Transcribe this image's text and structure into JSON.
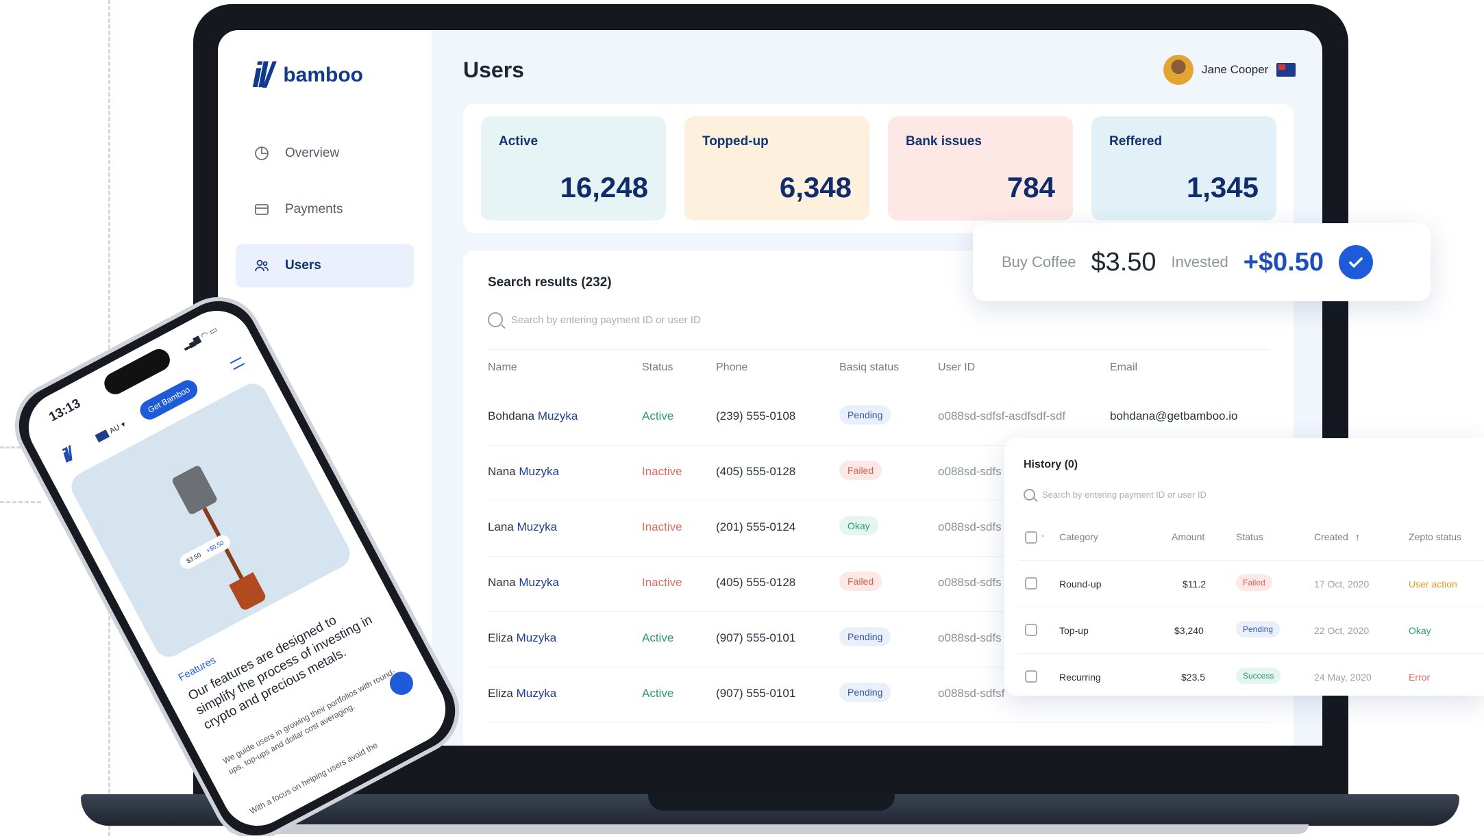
{
  "brand": {
    "name": "bamboo",
    "logo_mark": "il/"
  },
  "sidebar": {
    "items": [
      {
        "label": "Overview",
        "icon": "pie-chart-icon",
        "active": false
      },
      {
        "label": "Payments",
        "icon": "card-icon",
        "active": false
      },
      {
        "label": "Users",
        "icon": "users-icon",
        "active": true
      }
    ]
  },
  "header": {
    "title": "Users",
    "user_name": "Jane Cooper",
    "flag": "australia-flag-icon"
  },
  "stats": [
    {
      "label": "Active",
      "value": "16,248",
      "color": "#e6f4f5"
    },
    {
      "label": "Topped-up",
      "value": "6,348",
      "color": "#fdf0dc"
    },
    {
      "label": "Bank issues",
      "value": "784",
      "color": "#fde8e6"
    },
    {
      "label": "Reffered",
      "value": "1,345",
      "color": "#e2f1f8"
    }
  ],
  "results": {
    "title": "Search results (232)",
    "search_placeholder": "Search by entering payment ID or user ID",
    "columns": [
      "Name",
      "Status",
      "Phone",
      "Basiq status",
      "User ID",
      "Email"
    ],
    "rows": [
      {
        "first": "Bohdana",
        "last": "Muzyka",
        "status": "Active",
        "phone": "(239) 555-0108",
        "basiq": "Pending",
        "user_id": "o088sd-sdfsf-asdfsdf-sdf",
        "email": "bohdana@getbamboo.io"
      },
      {
        "first": "Nana",
        "last": "Muzyka",
        "status": "Inactive",
        "phone": "(405) 555-0128",
        "basiq": "Failed",
        "user_id": "o088sd-sdfs",
        "email": ""
      },
      {
        "first": "Lana",
        "last": "Muzyka",
        "status": "Inactive",
        "phone": "(201) 555-0124",
        "basiq": "Okay",
        "user_id": "o088sd-sdfs",
        "email": ""
      },
      {
        "first": "Nana",
        "last": "Muzyka",
        "status": "Inactive",
        "phone": "(405) 555-0128",
        "basiq": "Failed",
        "user_id": "o088sd-sdfs",
        "email": ""
      },
      {
        "first": "Eliza",
        "last": "Muzyka",
        "status": "Active",
        "phone": "(907) 555-0101",
        "basiq": "Pending",
        "user_id": "o088sd-sdfs",
        "email": ""
      },
      {
        "first": "Eliza",
        "last": "Muzyka",
        "status": "Active",
        "phone": "(907) 555-0101",
        "basiq": "Pending",
        "user_id": "o088sd-sdfsf",
        "email": ""
      }
    ]
  },
  "coffee_card": {
    "label": "Buy Coffee",
    "amount": "$3.50",
    "invested_label": "Invested",
    "invested_amount": "+$0.50"
  },
  "history": {
    "title": "History (0)",
    "search_placeholder": "Search by entering payment ID or user ID",
    "columns": [
      "Category",
      "Amount",
      "Status",
      "Created",
      "Zepto status"
    ],
    "rows": [
      {
        "category": "Round-up",
        "amount": "$11.2",
        "status": "Failed",
        "created": "17 Oct, 2020",
        "zepto": "User action"
      },
      {
        "category": "Top-up",
        "amount": "$3,240",
        "status": "Pending",
        "created": "22 Oct, 2020",
        "zepto": "Okay"
      },
      {
        "category": "Recurring",
        "amount": "$23.5",
        "status": "Success",
        "created": "24 May, 2020",
        "zepto": "Error"
      }
    ]
  },
  "phone": {
    "time": "13:13",
    "lang": "AU",
    "cta": "Get Bamboo",
    "chip_left": "$3.50",
    "chip_right": "+$0.50",
    "features_label": "Features",
    "heading": "Our features are designed to simplify the process of investing in crypto and precious metals.",
    "body": "We guide users in growing their portfolios with round-ups, top-ups and dollar cost averaging.",
    "body2": "With a focus on helping users avoid the"
  }
}
